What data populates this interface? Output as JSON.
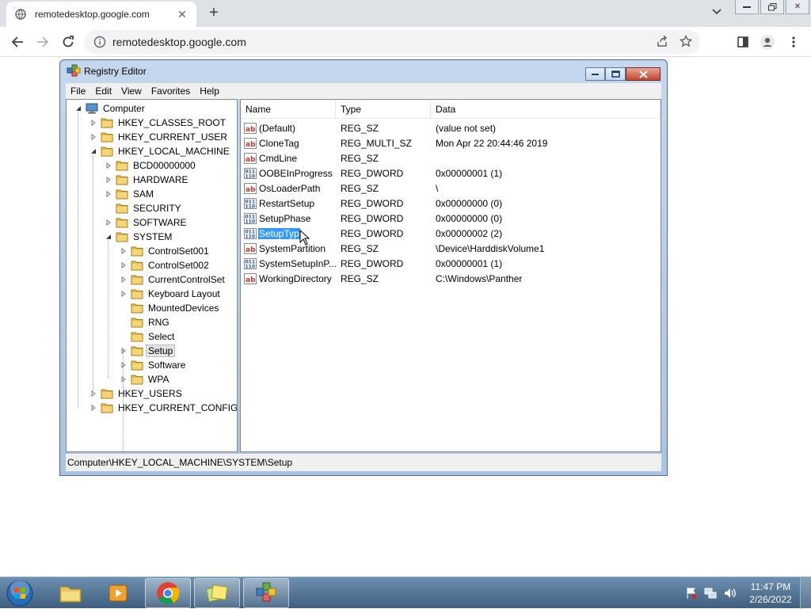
{
  "browser": {
    "tab_title": "remotedesktop.google.com",
    "url": "remotedesktop.google.com"
  },
  "regedit": {
    "title": "Registry Editor",
    "menu": [
      "File",
      "Edit",
      "View",
      "Favorites",
      "Help"
    ],
    "tree": [
      {
        "label": "Computer",
        "level": 0,
        "expander": "open",
        "icon": "computer"
      },
      {
        "label": "HKEY_CLASSES_ROOT",
        "level": 1,
        "expander": "closed",
        "icon": "folder"
      },
      {
        "label": "HKEY_CURRENT_USER",
        "level": 1,
        "expander": "closed",
        "icon": "folder"
      },
      {
        "label": "HKEY_LOCAL_MACHINE",
        "level": 1,
        "expander": "open",
        "icon": "folder"
      },
      {
        "label": "BCD00000000",
        "level": 2,
        "expander": "closed",
        "icon": "folder"
      },
      {
        "label": "HARDWARE",
        "level": 2,
        "expander": "closed",
        "icon": "folder"
      },
      {
        "label": "SAM",
        "level": 2,
        "expander": "closed",
        "icon": "folder"
      },
      {
        "label": "SECURITY",
        "level": 2,
        "expander": "none",
        "icon": "folder"
      },
      {
        "label": "SOFTWARE",
        "level": 2,
        "expander": "closed",
        "icon": "folder"
      },
      {
        "label": "SYSTEM",
        "level": 2,
        "expander": "open",
        "icon": "folder"
      },
      {
        "label": "ControlSet001",
        "level": 3,
        "expander": "closed",
        "icon": "folder"
      },
      {
        "label": "ControlSet002",
        "level": 3,
        "expander": "closed",
        "icon": "folder"
      },
      {
        "label": "CurrentControlSet",
        "level": 3,
        "expander": "closed",
        "icon": "folder"
      },
      {
        "label": "Keyboard Layout",
        "level": 3,
        "expander": "closed",
        "icon": "folder"
      },
      {
        "label": "MountedDevices",
        "level": 3,
        "expander": "none",
        "icon": "folder"
      },
      {
        "label": "RNG",
        "level": 3,
        "expander": "none",
        "icon": "folder"
      },
      {
        "label": "Select",
        "level": 3,
        "expander": "none",
        "icon": "folder"
      },
      {
        "label": "Setup",
        "level": 3,
        "expander": "closed",
        "icon": "folder",
        "selected": true
      },
      {
        "label": "Software",
        "level": 3,
        "expander": "closed",
        "icon": "folder"
      },
      {
        "label": "WPA",
        "level": 3,
        "expander": "closed",
        "icon": "folder"
      },
      {
        "label": "HKEY_USERS",
        "level": 1,
        "expander": "closed",
        "icon": "folder"
      },
      {
        "label": "HKEY_CURRENT_CONFIG",
        "level": 1,
        "expander": "closed",
        "icon": "folder"
      }
    ],
    "columns": [
      "Name",
      "Type",
      "Data"
    ],
    "values": [
      {
        "name": "(Default)",
        "type": "REG_SZ",
        "data": "(value not set)",
        "icon": "string-value-icon"
      },
      {
        "name": "CloneTag",
        "type": "REG_MULTI_SZ",
        "data": "Mon Apr 22 20:44:46 2019",
        "icon": "string-value-icon"
      },
      {
        "name": "CmdLine",
        "type": "REG_SZ",
        "data": "",
        "icon": "string-value-icon"
      },
      {
        "name": "OOBEInProgress",
        "type": "REG_DWORD",
        "data": "0x00000001 (1)",
        "icon": "binary-value-icon"
      },
      {
        "name": "OsLoaderPath",
        "type": "REG_SZ",
        "data": "\\",
        "icon": "string-value-icon"
      },
      {
        "name": "RestartSetup",
        "type": "REG_DWORD",
        "data": "0x00000000 (0)",
        "icon": "binary-value-icon"
      },
      {
        "name": "SetupPhase",
        "type": "REG_DWORD",
        "data": "0x00000000 (0)",
        "icon": "binary-value-icon"
      },
      {
        "name": "SetupTyp",
        "type": "REG_DWORD",
        "data": "0x00000002 (2)",
        "icon": "binary-value-icon",
        "selected": true
      },
      {
        "name": "SystemPartition",
        "type": "REG_SZ",
        "data": "\\Device\\HarddiskVolume1",
        "icon": "string-value-icon"
      },
      {
        "name": "SystemSetupInP...",
        "type": "REG_DWORD",
        "data": "0x00000001 (1)",
        "icon": "binary-value-icon"
      },
      {
        "name": "WorkingDirectory",
        "type": "REG_SZ",
        "data": "C:\\Windows\\Panther",
        "icon": "string-value-icon"
      }
    ],
    "status": "Computer\\HKEY_LOCAL_MACHINE\\SYSTEM\\Setup"
  },
  "taskbar": {
    "time": "11:47 PM",
    "date": "2/26/2022"
  },
  "colors": {
    "selection": "#3399ff",
    "window_frame": "#a9c4e3",
    "taskbar": "#4b6b8c"
  }
}
